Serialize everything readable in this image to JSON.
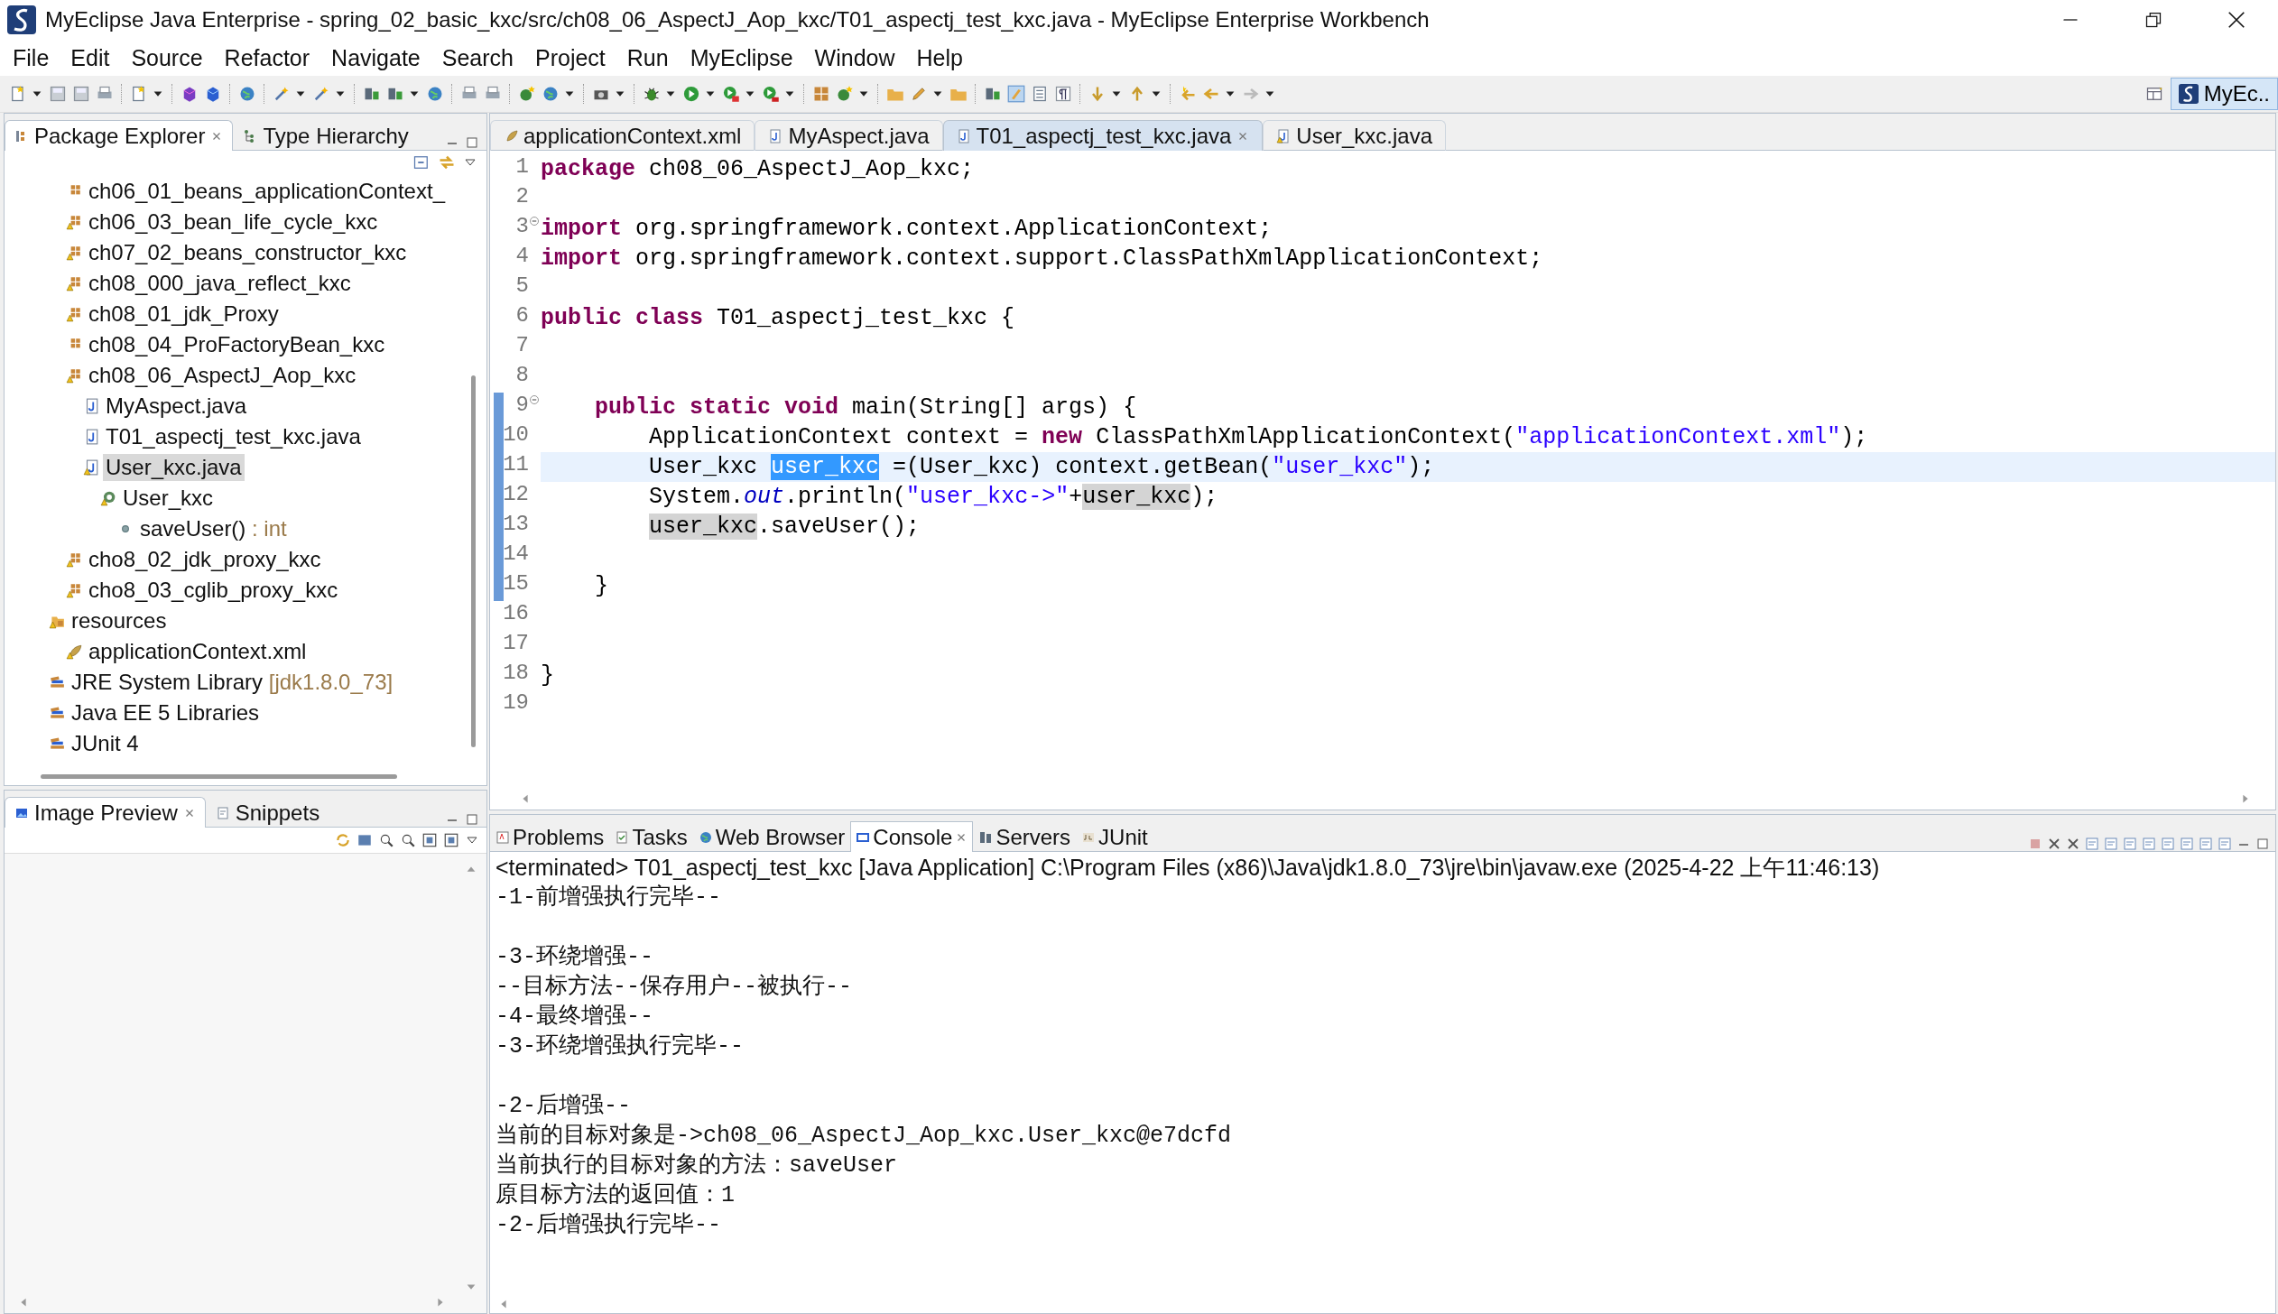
{
  "window": {
    "title": "MyEclipse Java Enterprise - spring_02_basic_kxc/src/ch08_06_AspectJ_Aop_kxc/T01_aspectj_test_kxc.java - MyEclipse Enterprise Workbench"
  },
  "menu": [
    "File",
    "Edit",
    "Source",
    "Refactor",
    "Navigate",
    "Search",
    "Project",
    "Run",
    "MyEclipse",
    "Window",
    "Help"
  ],
  "perspective": {
    "label": "MyEc..",
    "selected": true
  },
  "explorer": {
    "tabs": [
      {
        "label": "Package Explorer",
        "selected": true,
        "closable": true
      },
      {
        "label": "Type Hierarchy",
        "selected": false,
        "closable": false
      }
    ],
    "source_folder_contents": [
      {
        "label": "ch06_01_beans_applicationContext_",
        "kind": "package",
        "warning": false,
        "selected": false
      },
      {
        "label": "ch06_03_bean_life_cycle_kxc",
        "kind": "package",
        "warning": true,
        "selected": false
      },
      {
        "label": "ch07_02_beans_constructor_kxc",
        "kind": "package",
        "warning": true,
        "selected": false
      },
      {
        "label": "ch08_000_java_reflect_kxc",
        "kind": "package",
        "warning": true,
        "selected": false
      },
      {
        "label": "ch08_01_jdk_Proxy",
        "kind": "package",
        "warning": true,
        "selected": false
      },
      {
        "label": "ch08_04_ProFactoryBean_kxc",
        "kind": "package",
        "warning": false,
        "selected": false
      },
      {
        "label": "ch08_06_AspectJ_Aop_kxc",
        "kind": "package",
        "warning": true,
        "selected": false,
        "children": [
          {
            "label": "MyAspect.java",
            "kind": "java-file",
            "warning": false,
            "selected": false
          },
          {
            "label": "T01_aspectj_test_kxc.java",
            "kind": "java-file",
            "warning": false,
            "selected": false
          },
          {
            "label": "User_kxc.java",
            "kind": "java-file",
            "warning": true,
            "selected": true,
            "children": [
              {
                "label": "User_kxc",
                "kind": "class",
                "warning": true,
                "selected": false,
                "children": [
                  {
                    "label": "saveUser()",
                    "detail": ": int",
                    "kind": "method",
                    "warning": false,
                    "selected": false
                  }
                ]
              }
            ]
          }
        ]
      },
      {
        "label": "cho8_02_jdk_proxy_kxc",
        "kind": "package",
        "warning": true,
        "selected": false
      },
      {
        "label": "cho8_03_cglib_proxy_kxc",
        "kind": "package",
        "warning": true,
        "selected": false
      }
    ],
    "project_items": [
      {
        "label": "resources",
        "kind": "source-folder",
        "warning": true,
        "selected": false,
        "children": [
          {
            "label": "applicationContext.xml",
            "kind": "xml-file",
            "warning": true,
            "selected": false
          }
        ]
      },
      {
        "label": "JRE System Library",
        "detail": "[jdk1.8.0_73]",
        "kind": "library",
        "warning": false,
        "selected": false
      },
      {
        "label": "Java EE 5 Libraries",
        "kind": "library",
        "warning": false,
        "selected": false
      },
      {
        "label": "JUnit 4",
        "kind": "library",
        "warning": false,
        "selected": false
      }
    ]
  },
  "preview": {
    "tabs": [
      {
        "label": "Image Preview",
        "selected": true,
        "closable": true
      },
      {
        "label": "Snippets",
        "selected": false,
        "closable": false
      }
    ]
  },
  "editor": {
    "tabs": [
      {
        "label": "applicationContext.xml",
        "kind": "xml",
        "warning": false,
        "selected": false,
        "closable": false
      },
      {
        "label": "MyAspect.java",
        "kind": "java",
        "warning": false,
        "selected": false,
        "closable": false
      },
      {
        "label": "T01_aspectj_test_kxc.java",
        "kind": "java",
        "warning": false,
        "selected": true,
        "closable": true
      },
      {
        "label": "User_kxc.java",
        "kind": "java",
        "warning": true,
        "selected": false,
        "closable": false
      }
    ],
    "lines": [
      {
        "number": "1",
        "foldable": false,
        "current": false,
        "in_range": false,
        "tokens": [
          {
            "text": "package",
            "kind": "keyword"
          },
          {
            "text": " ch08_06_AspectJ_Aop_kxc;",
            "kind": "plain"
          }
        ]
      },
      {
        "number": "2",
        "foldable": false,
        "current": false,
        "in_range": false
      },
      {
        "number": "3",
        "foldable": true,
        "current": false,
        "in_range": false,
        "tokens": [
          {
            "text": "import",
            "kind": "keyword"
          },
          {
            "text": " org.springframework.context.ApplicationContext;",
            "kind": "plain"
          }
        ]
      },
      {
        "number": "4",
        "foldable": false,
        "current": false,
        "in_range": false,
        "tokens": [
          {
            "text": "import",
            "kind": "keyword"
          },
          {
            "text": " org.springframework.context.support.ClassPathXmlApplicationContext;",
            "kind": "plain"
          }
        ]
      },
      {
        "number": "5",
        "foldable": false,
        "current": false,
        "in_range": false
      },
      {
        "number": "6",
        "foldable": false,
        "current": false,
        "in_range": false,
        "tokens": [
          {
            "text": "public class",
            "kind": "keyword"
          },
          {
            "text": " T01_aspectj_test_kxc {",
            "kind": "plain"
          }
        ]
      },
      {
        "number": "7",
        "foldable": false,
        "current": false,
        "in_range": false
      },
      {
        "number": "8",
        "foldable": false,
        "current": false,
        "in_range": false
      },
      {
        "number": "9",
        "foldable": true,
        "current": false,
        "in_range": true,
        "tokens": [
          {
            "text": "    public static void",
            "kind": "keyword"
          },
          {
            "text": " main(String[] args) {",
            "kind": "plain"
          }
        ]
      },
      {
        "number": "10",
        "foldable": false,
        "current": false,
        "in_range": true,
        "tokens": [
          {
            "text": "        ApplicationContext context = ",
            "kind": "plain"
          },
          {
            "text": "new",
            "kind": "keyword"
          },
          {
            "text": " ClassPathXmlApplicationContext(",
            "kind": "plain"
          },
          {
            "text": "\"applicationContext.xml\"",
            "kind": "string"
          },
          {
            "text": ");",
            "kind": "plain"
          }
        ]
      },
      {
        "number": "11",
        "foldable": false,
        "current": true,
        "in_range": true,
        "tokens": [
          {
            "text": "        User_kxc ",
            "kind": "plain"
          },
          {
            "text": "user_kxc",
            "kind": "selection"
          },
          {
            "text": " =(User_kxc) context.getBean(",
            "kind": "plain"
          },
          {
            "text": "\"user_kxc\"",
            "kind": "string"
          },
          {
            "text": ");",
            "kind": "plain"
          }
        ]
      },
      {
        "number": "12",
        "foldable": false,
        "current": false,
        "in_range": true,
        "tokens": [
          {
            "text": "        System.",
            "kind": "plain"
          },
          {
            "text": "out",
            "kind": "field"
          },
          {
            "text": ".println(",
            "kind": "plain"
          },
          {
            "text": "\"user_kxc->\"",
            "kind": "string"
          },
          {
            "text": "+",
            "kind": "plain"
          },
          {
            "text": "user_kxc",
            "kind": "occurrence"
          },
          {
            "text": ");",
            "kind": "plain"
          }
        ]
      },
      {
        "number": "13",
        "foldable": false,
        "current": false,
        "in_range": true,
        "tokens": [
          {
            "text": "        user_kxc",
            "kind": "occurrence"
          },
          {
            "text": ".saveUser();",
            "kind": "plain"
          }
        ]
      },
      {
        "number": "14",
        "foldable": false,
        "current": false,
        "in_range": true
      },
      {
        "number": "15",
        "foldable": false,
        "current": false,
        "in_range": true,
        "tokens": [
          {
            "text": "    }",
            "kind": "plain"
          }
        ]
      },
      {
        "number": "16",
        "foldable": false,
        "current": false,
        "in_range": false
      },
      {
        "number": "17",
        "foldable": false,
        "current": false,
        "in_range": false
      },
      {
        "number": "18",
        "foldable": false,
        "current": false,
        "in_range": false,
        "tokens": [
          {
            "text": "}",
            "kind": "plain"
          }
        ]
      },
      {
        "number": "19",
        "foldable": false,
        "current": false,
        "in_range": false
      }
    ]
  },
  "console": {
    "tabs": [
      {
        "label": "Problems",
        "selected": false,
        "closable": false
      },
      {
        "label": "Tasks",
        "selected": false,
        "closable": false
      },
      {
        "label": "Web Browser",
        "selected": false,
        "closable": false
      },
      {
        "label": "Console",
        "selected": true,
        "closable": true
      },
      {
        "label": "Servers",
        "selected": false,
        "closable": false
      },
      {
        "label": "JUnit",
        "selected": false,
        "closable": false
      }
    ],
    "header": "<terminated> T01_aspectj_test_kxc [Java Application] C:\\Program Files (x86)\\Java\\jdk1.8.0_73\\jre\\bin\\javaw.exe (2025-4-22 上午11:46:13)",
    "lines": [
      {
        "text": "-1-前增强执行完毕--",
        "gap_before": false
      },
      {
        "text": "-3-环绕增强--",
        "gap_before": true
      },
      {
        "text": "--目标方法--保存用户--被执行--",
        "gap_before": false
      },
      {
        "text": "-4-最终增强--",
        "gap_before": false
      },
      {
        "text": "-3-环绕增强执行完毕--",
        "gap_before": false
      },
      {
        "text": "-2-后增强--",
        "gap_before": true
      },
      {
        "text": "当前的目标对象是->ch08_06_AspectJ_Aop_kxc.User_kxc@e7dcfd",
        "gap_before": false
      },
      {
        "text": "当前执行的目标对象的方法：saveUser",
        "gap_before": false
      },
      {
        "text": "原目标方法的返回值：1",
        "gap_before": false
      },
      {
        "text": "-2-后增强执行完毕--",
        "gap_before": false
      }
    ]
  }
}
